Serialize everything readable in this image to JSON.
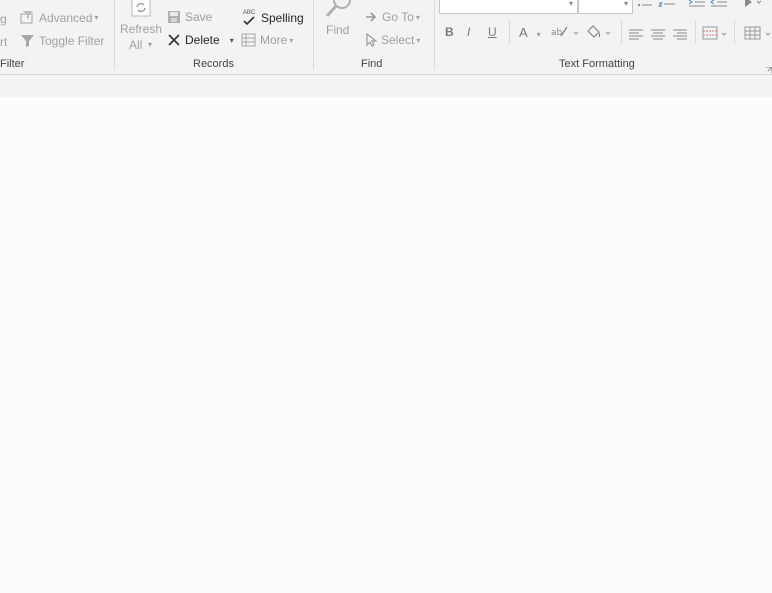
{
  "ribbon": {
    "sort_filter": {
      "partial_top": "g",
      "partial_bottom": "rt",
      "advanced_label": "Advanced",
      "toggle_filter_label": "Toggle Filter",
      "group_label": "Filter"
    },
    "records": {
      "refresh_label_line1": "Refresh",
      "refresh_label_line2": "All",
      "save_label": "Save",
      "delete_label": "Delete",
      "spelling_label": "Spelling",
      "more_label": "More",
      "group_label": "Records"
    },
    "find": {
      "find_label": "Find",
      "goto_label": "Go To",
      "select_label": "Select",
      "group_label": "Find"
    },
    "text_formatting": {
      "bold_label": "B",
      "italic_label": "I",
      "underline_label": "U",
      "font_color_label": "A",
      "spelling_abc": "ABC",
      "group_label": "Text Formatting"
    }
  },
  "icons": [
    "filter-icon",
    "advanced-filter-icon",
    "refresh-icon",
    "save-icon",
    "delete-icon",
    "spelling-icon",
    "more-icon",
    "find-icon",
    "goto-icon",
    "select-icon",
    "bullets-icon",
    "numbering-icon",
    "indent-icon",
    "gridlines-icon"
  ],
  "colors": {
    "ribbon_bg": "#f3f3f3",
    "canvas_bg": "#fbfbfb",
    "disabled": "#a0a0a0",
    "text": "#262626"
  }
}
